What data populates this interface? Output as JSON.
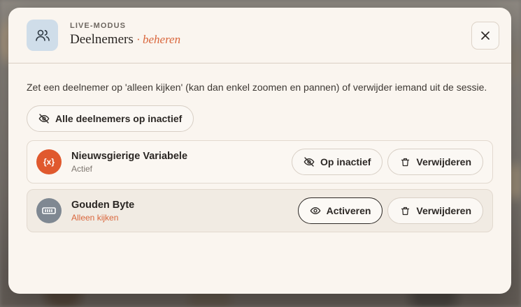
{
  "header": {
    "eyebrow": "LIVE-MODUS",
    "title": "Deelnemers",
    "title_accent": "· beheren",
    "icon": "users-icon",
    "close_icon": "close-icon"
  },
  "description": "Zet een deelnemer op 'alleen kijken' (kan dan enkel zoomen en pannen) of verwijder iemand uit de sessie.",
  "bulk_action": {
    "label": "Alle deelnemers op inactief",
    "icon": "eye-off-icon"
  },
  "participants": [
    {
      "name": "Nieuwsgierige Variabele",
      "status": "Actief",
      "avatar_glyph": "{x}",
      "avatar_color": "#e0592e",
      "toggle_label": "Op inactief",
      "toggle_icon": "eye-off-icon",
      "remove_label": "Verwijderen",
      "remove_icon": "trash-icon"
    },
    {
      "name": "Gouden Byte",
      "status": "Alleen kijken",
      "avatar_glyph": "",
      "avatar_color": "#7f8892",
      "toggle_label": "Activeren",
      "toggle_icon": "eye-icon",
      "remove_label": "Verwijderen",
      "remove_icon": "trash-icon"
    }
  ],
  "colors": {
    "accent": "#d9663c",
    "modal_bg": "#faf5ef",
    "header_icon_bg": "#cfdde9"
  }
}
